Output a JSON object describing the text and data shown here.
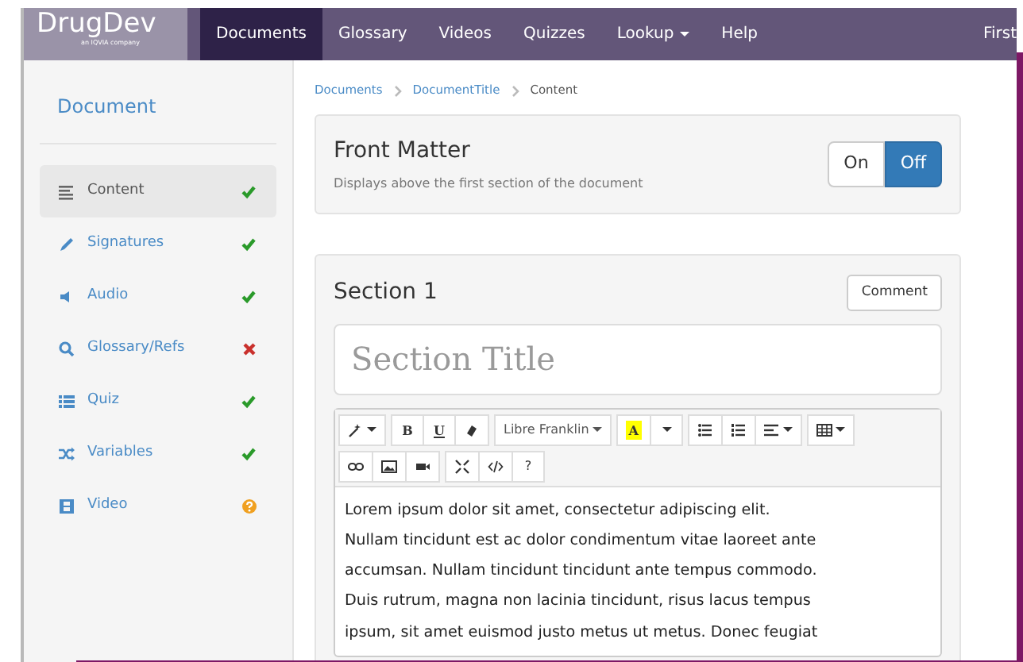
{
  "brand": {
    "name": "DrugDev",
    "tagline": "an IQVIA company"
  },
  "nav": [
    {
      "label": "Documents",
      "selected": true,
      "dropdown": false
    },
    {
      "label": "Glossary",
      "selected": false,
      "dropdown": false
    },
    {
      "label": "Videos",
      "selected": false,
      "dropdown": false
    },
    {
      "label": "Quizzes",
      "selected": false,
      "dropdown": false
    },
    {
      "label": "Lookup",
      "selected": false,
      "dropdown": true
    },
    {
      "label": "Help",
      "selected": false,
      "dropdown": false
    }
  ],
  "user": "First",
  "sidebar": {
    "title": "Document",
    "items": [
      {
        "label": "Content",
        "selected": true,
        "kind": "done"
      },
      {
        "label": "Signatures",
        "selected": false,
        "kind": "done"
      },
      {
        "label": "Audio",
        "selected": false,
        "kind": "done"
      },
      {
        "label": "Glossary/Refs",
        "selected": false,
        "kind": "error"
      },
      {
        "label": "Quiz",
        "selected": false,
        "kind": "done"
      },
      {
        "label": "Variables",
        "selected": false,
        "kind": "done"
      },
      {
        "label": "Video",
        "selected": false,
        "kind": "unknown"
      }
    ]
  },
  "breadcrumb": [
    "Documents",
    "DocumentTitle",
    "Content"
  ],
  "front_matter": {
    "title": "Front Matter",
    "description": "Displays above the first section of the document",
    "options": [
      {
        "label": "On",
        "selected": false
      },
      {
        "label": "Off",
        "selected": true
      }
    ]
  },
  "section": {
    "title": "Section 1",
    "comment_button": "Comment",
    "title_field": {
      "placeholder": "Section Title"
    },
    "toolbar": [
      [
        {
          "kind": "icon",
          "caret": true
        }
      ],
      [
        {
          "kind": "bold",
          "label": "B"
        },
        {
          "kind": "underline",
          "label": "U"
        },
        {
          "kind": "icon",
          "caret": false
        }
      ],
      [
        {
          "kind": "text",
          "label": "Libre Franklin",
          "caret": true
        }
      ],
      [
        {
          "kind": "highlight",
          "label": "A"
        },
        {
          "kind": "caret"
        }
      ],
      [
        {
          "kind": "icon",
          "caret": false
        },
        {
          "kind": "icon",
          "caret": false
        },
        {
          "kind": "icon",
          "caret": true
        }
      ],
      [
        {
          "kind": "icon",
          "caret": true
        }
      ],
      [
        {
          "kind": "icon",
          "caret": false
        },
        {
          "kind": "icon",
          "caret": false
        },
        {
          "kind": "icon",
          "caret": false
        }
      ],
      [
        {
          "kind": "icon",
          "caret": false
        },
        {
          "kind": "icon",
          "caret": false
        },
        {
          "kind": "text",
          "label": "?",
          "caret": false
        }
      ]
    ],
    "body": [
      "Lorem ipsum dolor sit amet, consectetur adipiscing elit.",
      "Nullam tincidunt est ac dolor condimentum vitae laoreet ante",
      "accumsan. Nullam tincidunt tincidunt ante tempus commodo.",
      "Duis rutrum, magna non lacinia tincidunt, risus lacus tempus",
      "ipsum, sit amet euismod justo metus ut metus. Donec feugiat"
    ]
  }
}
